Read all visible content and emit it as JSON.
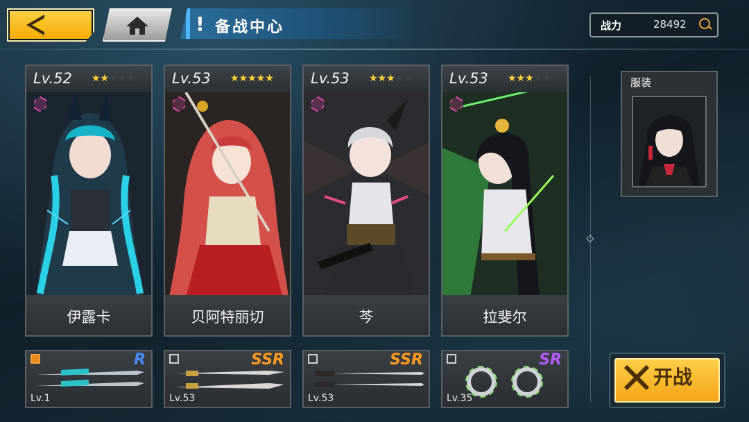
{
  "header": {
    "title": "备战中心",
    "power_label": "战力",
    "power_value": "28492"
  },
  "characters": [
    {
      "level": "Lv.52",
      "name": "伊露卡",
      "stars_filled": 2,
      "stars_total": 5
    },
    {
      "level": "Lv.53",
      "name": "贝阿特丽切",
      "stars_filled": 5,
      "stars_total": 5
    },
    {
      "level": "Lv.53",
      "name": "芩",
      "stars_filled": 3,
      "stars_total": 5
    },
    {
      "level": "Lv.53",
      "name": "拉斐尔",
      "stars_filled": 3,
      "stars_total": 5
    }
  ],
  "weapons": [
    {
      "rarity": "R",
      "rarity_color": "#4a8cff",
      "level": "Lv.1"
    },
    {
      "rarity": "SSR",
      "rarity_color": "#ff9a1c",
      "level": "Lv.53"
    },
    {
      "rarity": "SSR",
      "rarity_color": "#ff9a1c",
      "level": "Lv.53"
    },
    {
      "rarity": "SR",
      "rarity_color": "#b45cff",
      "level": "Lv.35"
    }
  ],
  "outfit": {
    "label": "服装"
  },
  "start_button": {
    "label": "开战"
  },
  "icons": [
    "back-arrow-icon",
    "home-icon",
    "exclamation-icon",
    "magnifier-icon",
    "star-icon",
    "rank-hexagon-icon",
    "weapon-slot-icon",
    "crossed-swords-icon"
  ]
}
